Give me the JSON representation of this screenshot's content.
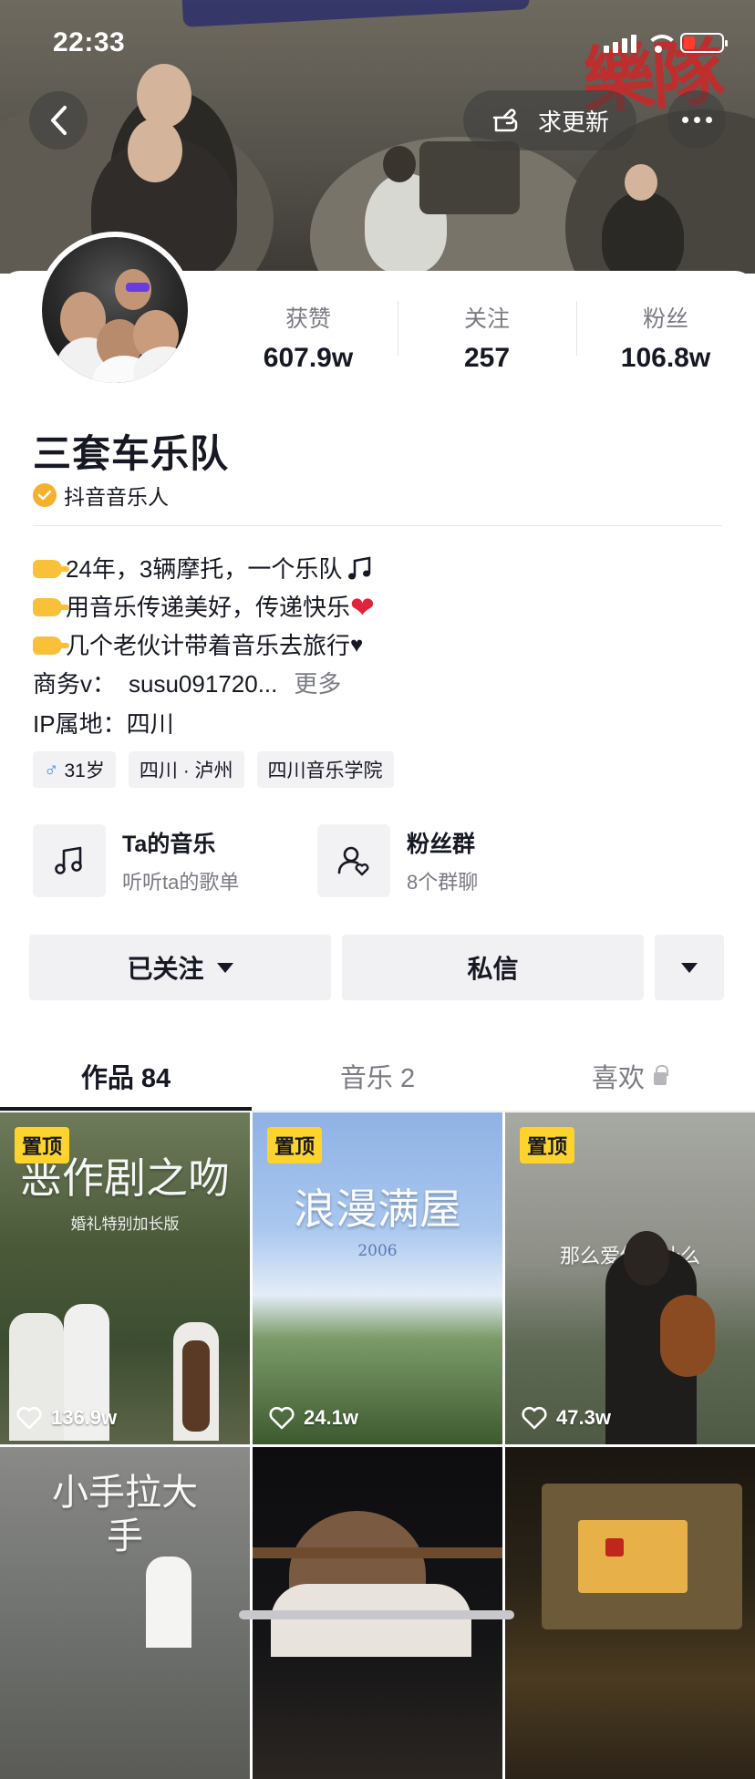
{
  "status_bar": {
    "time": "22:33"
  },
  "header": {
    "banner_text": "樂隊",
    "request_update_label": "求更新"
  },
  "profile": {
    "name": "三套车乐队",
    "verified_label": "抖音音乐人",
    "stats": [
      {
        "label": "获赞",
        "value": "607.9w"
      },
      {
        "label": "关注",
        "value": "257"
      },
      {
        "label": "粉丝",
        "value": "106.8w"
      }
    ],
    "bio": {
      "line1": "24年，3辆摩托，一个乐队",
      "line2": "用音乐传递美好，传递快乐",
      "line3": "几个老伙计带着音乐去旅行",
      "business_prefix": "商务v：",
      "business_value": "susu091720...",
      "more": "更多",
      "ip_location": "IP属地：四川"
    },
    "tags": [
      {
        "icon": "male-icon",
        "text": "31岁"
      },
      {
        "text": "四川 · 泸州"
      },
      {
        "text": "四川音乐学院"
      }
    ]
  },
  "entries": [
    {
      "icon": "music-note-icon",
      "title": "Ta的音乐",
      "subtitle": "听听ta的歌单"
    },
    {
      "icon": "fan-group-icon",
      "title": "粉丝群",
      "subtitle": "8个群聊"
    }
  ],
  "actions": {
    "followed": "已关注",
    "message": "私信"
  },
  "tabs": [
    {
      "label": "作品 84",
      "active": true
    },
    {
      "label": "音乐 2",
      "active": false
    },
    {
      "label": "喜欢",
      "active": false,
      "locked": true
    }
  ],
  "videos": [
    {
      "pinned": "置顶",
      "likes": "136.9w",
      "title": "恶作剧之吻",
      "subtitle": "婚礼特别加长版"
    },
    {
      "pinned": "置顶",
      "likes": "24.1w",
      "title": "浪漫满屋",
      "subtitle": "2006"
    },
    {
      "pinned": "置顶",
      "likes": "47.3w",
      "title": "那么爱你为什么",
      "subtitle": ""
    },
    {
      "pinned": "",
      "likes": "",
      "title": "小手拉大手",
      "subtitle": ""
    },
    {
      "pinned": "",
      "likes": "",
      "title": "",
      "subtitle": ""
    },
    {
      "pinned": "",
      "likes": "",
      "title": "",
      "subtitle": ""
    }
  ],
  "colors": {
    "accent_pin": "#fdd42e",
    "verified": "#f6b12b",
    "text_primary": "#161823",
    "text_secondary": "#7a7b83"
  }
}
